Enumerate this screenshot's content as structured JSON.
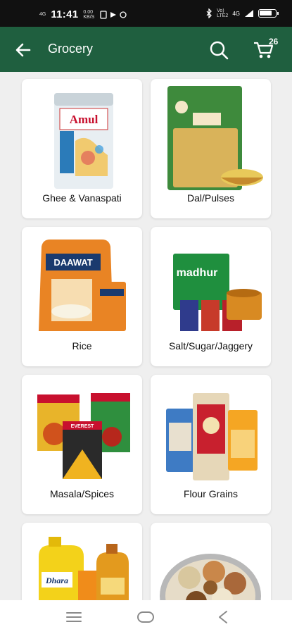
{
  "status_bar": {
    "time": "11:41",
    "speed": "0.00",
    "speed_unit": "KB/S",
    "signal_top": "4G",
    "network_top": "Vo)",
    "network_bottom": "LTE2",
    "network_type": "4G"
  },
  "app_bar": {
    "title": "Grocery",
    "cart_count": "26"
  },
  "categories": [
    {
      "label": "Ghee & Vanaspati",
      "brand": "Amul"
    },
    {
      "label": "Dal/Pulses"
    },
    {
      "label": "Rice",
      "brand": "DAAWAT"
    },
    {
      "label": "Salt/Sugar/Jaggery",
      "brand": "madhur"
    },
    {
      "label": "Masala/Spices",
      "brand": "EVEREST"
    },
    {
      "label": "Flour Grains"
    },
    {
      "label": "",
      "brand": "Dhara"
    },
    {
      "label": ""
    }
  ],
  "colors": {
    "app_bar": "#1f5f3f",
    "background": "#efefef",
    "card": "#ffffff"
  }
}
